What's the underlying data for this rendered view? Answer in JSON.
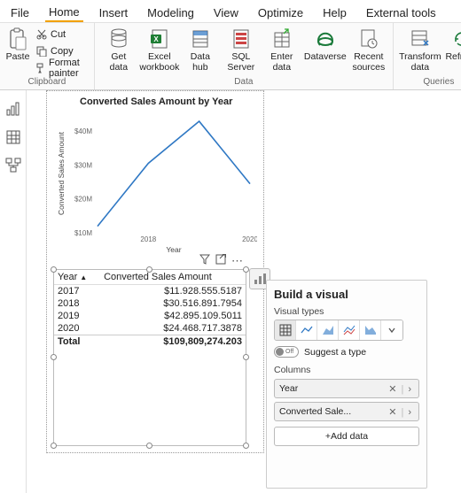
{
  "tabs": [
    "File",
    "Home",
    "Insert",
    "Modeling",
    "View",
    "Optimize",
    "Help",
    "External tools"
  ],
  "active_tab": "Home",
  "ribbon": {
    "clipboard": {
      "paste": "Paste",
      "cut": "Cut",
      "copy": "Copy",
      "format_painter": "Format painter",
      "group_label": "Clipboard"
    },
    "data": {
      "get_data": "Get\ndata",
      "excel": "Excel\nworkbook",
      "data_hub": "Data\nhub",
      "sql": "SQL\nServer",
      "enter": "Enter\ndata",
      "dataverse": "Dataverse",
      "recent": "Recent\nsources",
      "group_label": "Data"
    },
    "queries": {
      "transform": "Transform\ndata",
      "refresh": "Refresh",
      "group_label": "Queries"
    }
  },
  "chart_data": {
    "type": "line",
    "title": "Converted Sales Amount by Year",
    "xlabel": "Year",
    "ylabel": "Converted Sales Amount",
    "x": [
      2017,
      2018,
      2019,
      2020
    ],
    "y": [
      11928555.5187,
      30516891.7954,
      42895109.5011,
      24468717.3878
    ],
    "x_ticks": [
      "2018",
      "2020"
    ],
    "y_ticks": [
      "$10M",
      "$20M",
      "$30M",
      "$40M"
    ],
    "ylim": [
      10000000,
      45000000
    ]
  },
  "table": {
    "headers": [
      "Year",
      "Converted Sales Amount"
    ],
    "rows": [
      {
        "year": "2017",
        "amount": "$11.928.555.5187"
      },
      {
        "year": "2018",
        "amount": "$30.516.891.7954"
      },
      {
        "year": "2019",
        "amount": "$42.895.109.5011"
      },
      {
        "year": "2020",
        "amount": "$24.468.717.3878"
      }
    ],
    "total_label": "Total",
    "total_value": "$109,809,274.203"
  },
  "pane": {
    "title": "Build a visual",
    "visual_types_label": "Visual types",
    "suggest_label": "Suggest a type",
    "toggle_state": "Off",
    "columns_label": "Columns",
    "fields": [
      {
        "label": "Year"
      },
      {
        "label": "Converted Sale..."
      }
    ],
    "add_data": "+Add data"
  }
}
